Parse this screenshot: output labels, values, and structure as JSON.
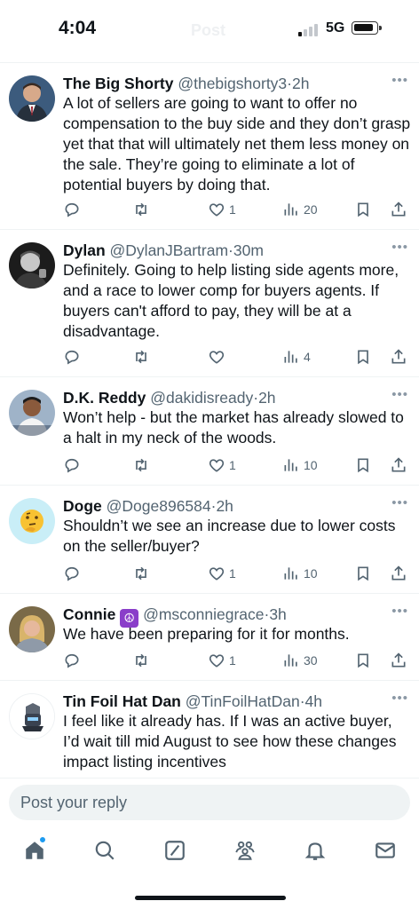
{
  "status_bar": {
    "time": "4:04",
    "network": "5G",
    "ghost_title": "Post"
  },
  "posts": [
    {
      "name": "The Big Shorty",
      "handle": "@thebigshorty3",
      "time": "2h",
      "text": "A lot of sellers are going to want to offer no compensation to the buy side and they don’t grasp yet that that will ultimately net them less money on the sale. They’re going to eliminate a lot of potential buyers by doing that.",
      "likes": "1",
      "views": "20",
      "avatar": "suit-man-avatar"
    },
    {
      "name": "Dylan",
      "handle": "@DylanJBartram",
      "time": "30m",
      "text": "Definitely. Going to help listing side agents more, and a race to lower comp for buyers agents. If buyers can't afford to pay, they will be at a disadvantage.",
      "likes": "",
      "views": "4",
      "avatar": "bw-portrait-avatar"
    },
    {
      "name": "D.K. Reddy",
      "handle": "@dakidisready",
      "time": "2h",
      "text": "Won’t help - but the market has already slowed to a halt in my neck of the woods.",
      "likes": "1",
      "views": "10",
      "avatar": "man-portrait-avatar"
    },
    {
      "name": "Doge",
      "handle": "@Doge896584",
      "time": "2h",
      "text": "Shouldn’t we see an increase due to lower costs on the seller/buyer?",
      "likes": "1",
      "views": "10",
      "avatar": "thinking-face-avatar"
    },
    {
      "name": "Connie",
      "badge": "☮",
      "handle": "@msconniegrace",
      "time": "3h",
      "text": "We have been preparing for it for months.",
      "likes": "1",
      "views": "30",
      "avatar": "woman-portrait-avatar"
    },
    {
      "name": "Tin Foil Hat Dan",
      "handle": "@TinFoilHatDan",
      "time": "4h",
      "text": "I feel like it already has. If I was an active buyer, I’d wait till mid August to see how these changes impact listing incentives",
      "avatar": "robot-logo-avatar"
    }
  ],
  "reply": {
    "placeholder": "Post your reply"
  },
  "tabbar": {
    "icons": [
      "home-icon",
      "search-icon",
      "grok-icon",
      "communities-icon",
      "notifications-icon",
      "messages-icon"
    ],
    "accent": "#1d9bf0"
  },
  "colors": {
    "text": "#0f1419",
    "secondary": "#536471",
    "divider": "#eff3f4",
    "badge": "#8a3ec9"
  }
}
